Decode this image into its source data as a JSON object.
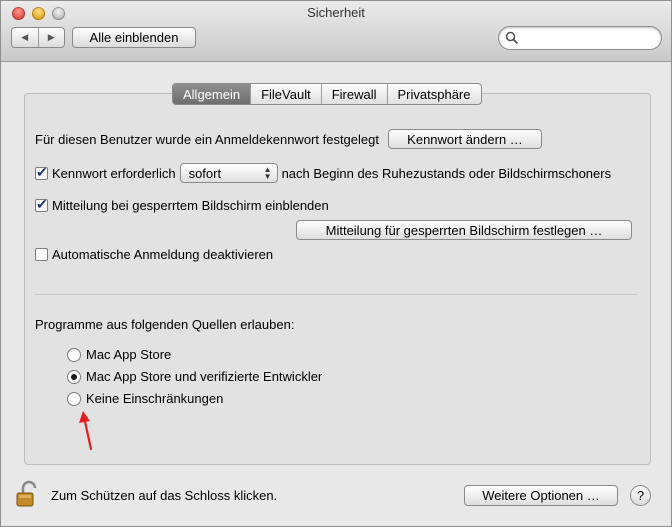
{
  "window": {
    "title": "Sicherheit"
  },
  "toolbar": {
    "back_glyph": "◀",
    "forward_glyph": "▶",
    "show_all_label": "Alle einblenden",
    "search_placeholder": "",
    "search_value": ""
  },
  "tabs": [
    {
      "label": "Allgemein",
      "active": true
    },
    {
      "label": "FileVault",
      "active": false
    },
    {
      "label": "Firewall",
      "active": false
    },
    {
      "label": "Privatsphäre",
      "active": false
    }
  ],
  "general": {
    "password_set_text": "Für diesen Benutzer wurde ein Anmeldekennwort festgelegt",
    "change_password_button": "Kennwort ändern …",
    "require_password_label": "Kennwort erforderlich",
    "require_password_checked": true,
    "require_password_select": "sofort",
    "require_password_suffix": "nach Beginn des Ruhezustands oder Bildschirmschoners",
    "lock_message_label": "Mitteilung bei gesperrtem Bildschirm einblenden",
    "lock_message_checked": true,
    "set_lock_message_button": "Mitteilung für gesperrten Bildschirm festlegen …",
    "disable_autologin_label": "Automatische Anmeldung deaktivieren",
    "disable_autologin_checked": false
  },
  "sources": {
    "heading": "Programme aus folgenden Quellen erlauben:",
    "options": [
      {
        "label": "Mac App Store",
        "selected": false
      },
      {
        "label": "Mac App Store und verifizierte Entwickler",
        "selected": true
      },
      {
        "label": "Keine Einschränkungen",
        "selected": false
      }
    ]
  },
  "footer": {
    "lock_text": "Zum Schützen auf das Schloss klicken.",
    "advanced_button": "Weitere Optionen …",
    "help_label": "?"
  },
  "colors": {
    "annotation_arrow": "#e0201e"
  }
}
